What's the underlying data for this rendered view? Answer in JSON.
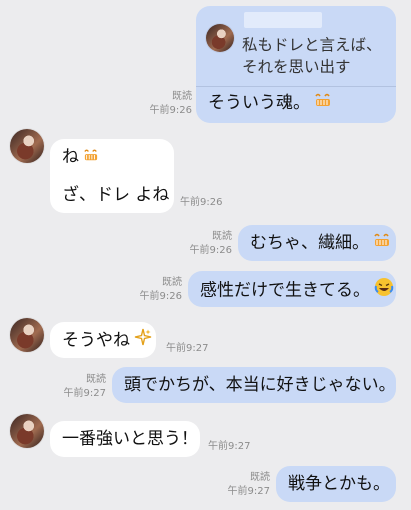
{
  "conversation": {
    "reply_block": {
      "quoted_text_line1": "私もドレと言えば、",
      "quoted_text_line2": "それを思い出す",
      "message": "そういう魂。",
      "read_label": "既読",
      "time": "午前9:26"
    },
    "msg_in_1": {
      "line1": "ね",
      "line2": "ざ、ドレ よね",
      "time": "午前9:26"
    },
    "msg_out_1": {
      "text": "むちゃ、繊細。",
      "read_label": "既読",
      "time": "午前9:26"
    },
    "msg_out_2": {
      "text": "感性だけで生きてる。",
      "read_label": "既読",
      "time": "午前9:26"
    },
    "msg_in_2": {
      "text": "そうやね",
      "time": "午前9:27"
    },
    "msg_out_3": {
      "text": "頭でかちが、本当に好きじゃない。",
      "read_label": "既読",
      "time": "午前9:27"
    },
    "msg_in_3": {
      "text": "一番強いと思う！",
      "time": "午前9:27"
    },
    "msg_out_4": {
      "text": "戦争とかも。",
      "read_label": "既読",
      "time": "午前9:27"
    }
  },
  "icons": {
    "grin": "grin-emoji-icon",
    "laugh": "laughing-tears-emoji-icon",
    "sparkle": "sparkles-emoji-icon"
  }
}
